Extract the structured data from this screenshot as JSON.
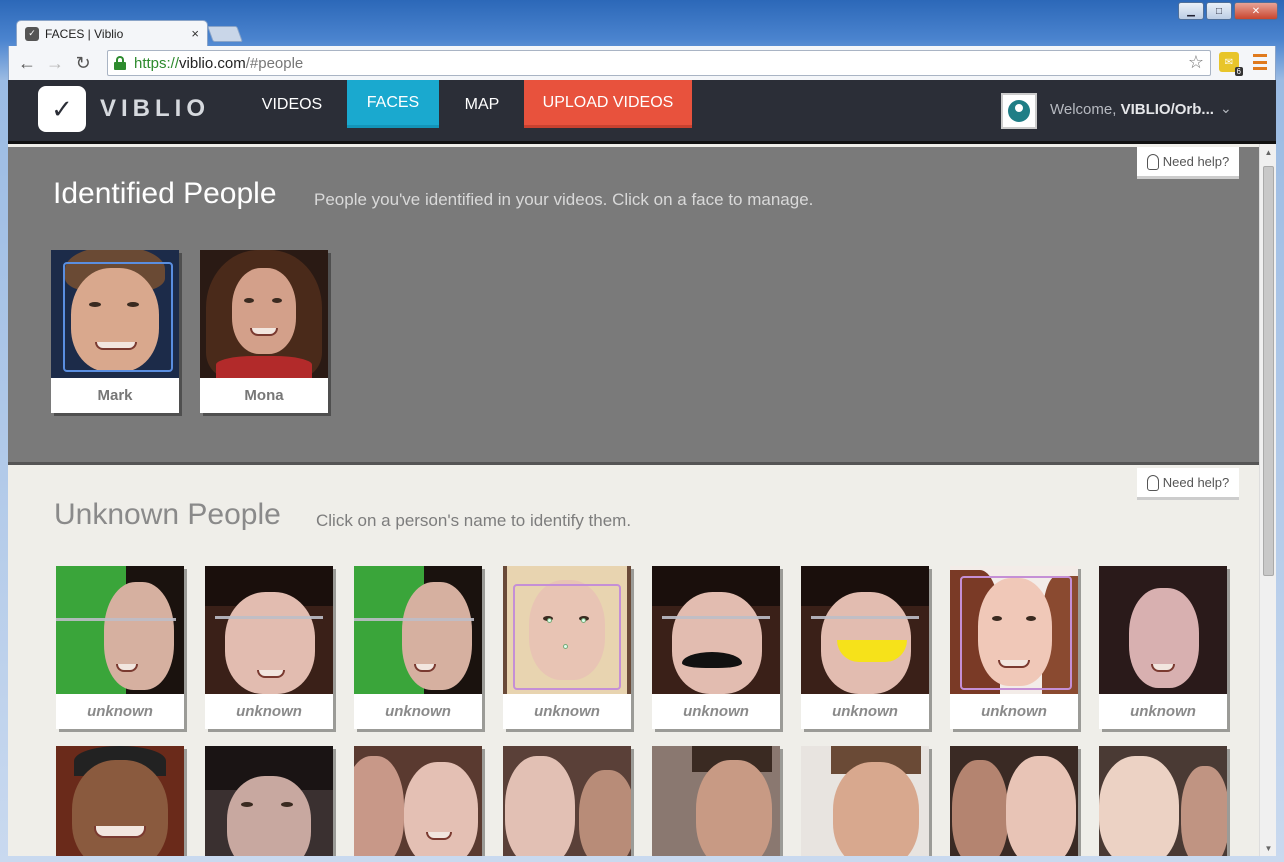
{
  "browser": {
    "tab_title": "FACES | Viblio",
    "tab_close": "×",
    "url_scheme": "https://",
    "url_host": "viblio.com",
    "url_path": "/#people",
    "back": "←",
    "forward": "→",
    "reload": "↻",
    "star": "☆",
    "extension_badge": "6",
    "window_minimize": "▁",
    "window_maximize": "□",
    "window_close": "✕"
  },
  "app": {
    "logo_text": "VIBLIO",
    "nav": {
      "videos": "VIDEOS",
      "faces": "FACES",
      "map": "MAP",
      "upload": "UPLOAD VIDEOS"
    },
    "welcome_prefix": "Welcome, ",
    "welcome_user": "VIBLIO/Orb...",
    "chevron": "⌄",
    "colors": {
      "header_bg": "#2b2e37",
      "faces_active": "#1aa9cf",
      "upload": "#e8523d",
      "identified_bg": "#7a7a7a",
      "unknown_bg": "#efeee9"
    }
  },
  "identified": {
    "title": "Identified People",
    "subtitle": "People you've identified in your videos. Click on a face to manage.",
    "need_help": "Need help?",
    "people": [
      {
        "name": "Mark"
      },
      {
        "name": "Mona"
      }
    ]
  },
  "unknown": {
    "title": "Unknown People",
    "subtitle": "Click on a person's name to identify them.",
    "need_help": "Need help?",
    "row1": [
      {
        "label": "unknown"
      },
      {
        "label": "unknown"
      },
      {
        "label": "unknown"
      },
      {
        "label": "unknown"
      },
      {
        "label": "unknown"
      },
      {
        "label": "unknown"
      },
      {
        "label": "unknown"
      },
      {
        "label": "unknown"
      }
    ]
  }
}
